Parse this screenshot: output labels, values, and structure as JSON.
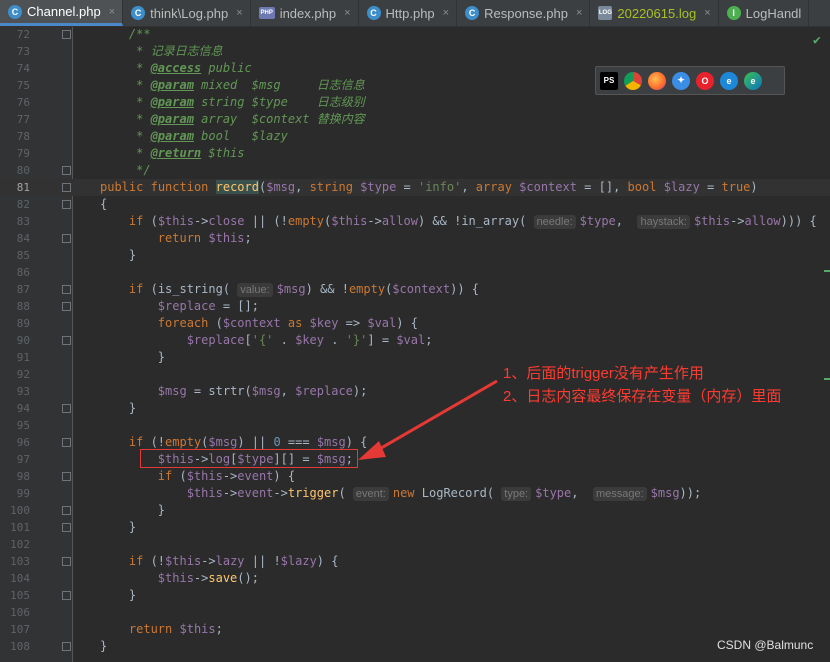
{
  "tabs": [
    {
      "label": "Channel.php",
      "icon": "C",
      "active": true
    },
    {
      "label": "think\\Log.php",
      "icon": "C",
      "active": false
    },
    {
      "label": "index.php",
      "icon": "PHP",
      "active": false
    },
    {
      "label": "Http.php",
      "icon": "C",
      "active": false
    },
    {
      "label": "Response.php",
      "icon": "C",
      "active": false
    },
    {
      "label": "20220615.log",
      "icon": "LOG",
      "active": false
    },
    {
      "label": "LogHandl",
      "icon": "I",
      "active": false
    }
  ],
  "line_numbers": [
    "72",
    "73",
    "74",
    "75",
    "76",
    "77",
    "78",
    "79",
    "80",
    "81",
    "82",
    "83",
    "84",
    "85",
    "86",
    "87",
    "88",
    "89",
    "90",
    "91",
    "92",
    "93",
    "94",
    "95",
    "96",
    "97",
    "98",
    "99",
    "100",
    "101",
    "102",
    "103",
    "104",
    "105",
    "106",
    "107",
    "108"
  ],
  "current_line": "81",
  "annotations": {
    "line1": "1、后面的trigger没有产生作用",
    "line2": "2、日志内容最终保存在变量（内存）里面"
  },
  "browser_icons": [
    "phpstorm-icon",
    "chrome-icon",
    "firefox-icon",
    "safari-icon",
    "opera-icon",
    "ie-icon",
    "edge-icon"
  ],
  "watermark": "CSDN @Balmunc",
  "code_tokens": {
    "l72": "/**",
    "l73": "* 记录日志信息",
    "l74a": "* ",
    "l74b": "@access",
    "l74c": " public",
    "l75a": "* ",
    "l75b": "@param",
    "l75c": " mixed  ",
    "l75d": "$msg",
    "l75e": "     日志信息",
    "l76a": "* ",
    "l76b": "@param",
    "l76c": " string ",
    "l76d": "$type",
    "l76e": "    日志级别",
    "l77a": "* ",
    "l77b": "@param",
    "l77c": " array  ",
    "l77d": "$context",
    "l77e": " 替换内容",
    "l78a": "* ",
    "l78b": "@param",
    "l78c": " bool   ",
    "l78d": "$lazy",
    "l79a": "* ",
    "l79b": "@return",
    "l79c": " $this",
    "l80": "*/",
    "kw_public": "public",
    "kw_function": "function",
    "fn_record": "record",
    "p_msg": "$msg",
    "kw_string": "string",
    "p_type": "$type",
    "op_eq": " = ",
    "s_info": "'info'",
    "kw_array": "array",
    "p_context": "$context",
    "arr_empty": "[]",
    "kw_bool": "bool",
    "p_lazy": "$lazy",
    "kw_true": "true",
    "brace_open": "{",
    "brace_close": "}",
    "kw_if": "if",
    "this": "$this",
    "arrow": "->",
    "close": "close",
    "or": " || ",
    "empty": "empty",
    "allow": "allow",
    "and": " && ",
    "in_array": "in_array",
    "hint_needle": "needle:",
    "hint_haystack": "haystack:",
    "kw_return": "return",
    "is_string": "is_string",
    "hint_value": "value:",
    "p_replace": "$replace",
    "kw_foreach": "foreach",
    "kw_as": "as",
    "p_key": "$key",
    "p_val": "$val",
    "s_lb": "'{'",
    "dot": " . ",
    "s_rb": "'}'",
    "strtr": "strtr",
    "zero": "0",
    "eqq": " === ",
    "log": "log",
    "event": "event",
    "trigger": "trigger",
    "hint_event": "event:",
    "kw_new": "new",
    "LogRecord": "LogRecord",
    "hint_type": "type:",
    "hint_message": "message:",
    "lazy": "lazy",
    "save": "save"
  }
}
